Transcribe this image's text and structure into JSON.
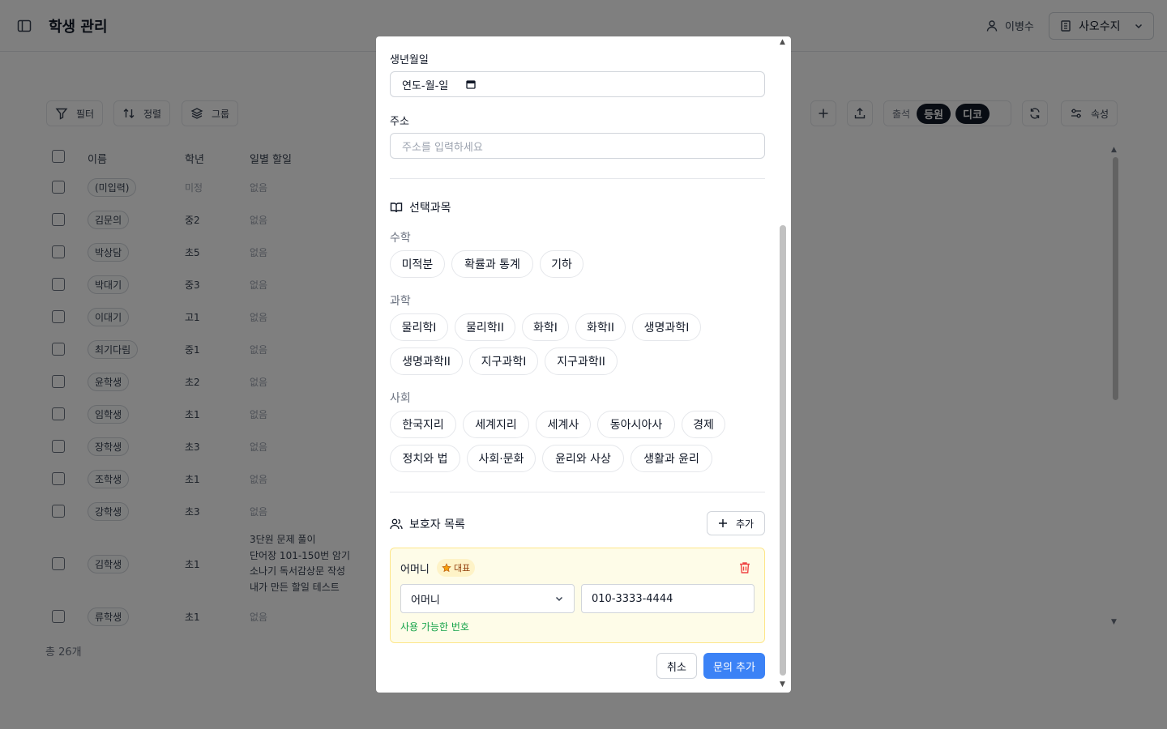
{
  "app": {
    "title": "학생 관리",
    "user_name": "이병수",
    "org_name": "사오수지"
  },
  "toolbar": {
    "filter_label": "필터",
    "sort_label": "정렬",
    "group_label": "그룹",
    "status_options": [
      "출석",
      "등원",
      "디코"
    ],
    "properties_label": "속성"
  },
  "table": {
    "headers": {
      "name": "이름",
      "grade": "학년",
      "todo": "일별 할일"
    },
    "rows": [
      {
        "name": "(미입력)",
        "grade": "미정",
        "todo": "없음"
      },
      {
        "name": "김문의",
        "grade": "중2",
        "todo": "없음"
      },
      {
        "name": "박상담",
        "grade": "초5",
        "todo": "없음"
      },
      {
        "name": "박대기",
        "grade": "중3",
        "todo": "없음"
      },
      {
        "name": "이대기",
        "grade": "고1",
        "todo": "없음"
      },
      {
        "name": "최기다림",
        "grade": "중1",
        "todo": "없음"
      },
      {
        "name": "윤학생",
        "grade": "초2",
        "todo": "없음"
      },
      {
        "name": "임학생",
        "grade": "초1",
        "todo": "없음"
      },
      {
        "name": "장학생",
        "grade": "초3",
        "todo": "없음"
      },
      {
        "name": "조학생",
        "grade": "초1",
        "todo": "없음"
      },
      {
        "name": "강학생",
        "grade": "초3",
        "todo": "없음"
      },
      {
        "name": "김학생",
        "grade": "초1",
        "todo_lines": [
          "3단원 문제 풀이",
          "단어장 101-150번 암기",
          "소나기 독서감상문 작성",
          "내가 만든 할일 테스트"
        ]
      },
      {
        "name": "류학생",
        "grade": "초1",
        "todo": "없음"
      }
    ],
    "total": "총 26개"
  },
  "modal": {
    "birthdate_label": "생년월일",
    "birthdate_value": "연도-월-일",
    "address_label": "주소",
    "address_placeholder": "주소를 입력하세요",
    "subjects_title": "선택과목",
    "categories": [
      {
        "label": "수학",
        "subjects": [
          "미적분",
          "확률과 통계",
          "기하"
        ]
      },
      {
        "label": "과학",
        "subjects": [
          "물리학I",
          "물리학II",
          "화학I",
          "화학II",
          "생명과학I",
          "생명과학II",
          "지구과학I",
          "지구과학II"
        ]
      },
      {
        "label": "사회",
        "subjects": [
          "한국지리",
          "세계지리",
          "세계사",
          "동아시아사",
          "경제",
          "정치와 법",
          "사회·문화",
          "윤리와 사상",
          "생활과 윤리"
        ]
      }
    ],
    "guardians_title": "보호자 목록",
    "add_label": "추가",
    "guardian": {
      "name": "어머니",
      "badge": "대표",
      "relation": "어머니",
      "phone": "010-3333-4444",
      "status": "사용 가능한 번호"
    },
    "cancel_label": "취소",
    "submit_label": "문의 추가"
  },
  "colors": {
    "primary": "#3b82f6",
    "success": "#16a34a",
    "danger": "#ef4444",
    "guardian_card_bg": "#fefce8",
    "badge_star": "#f59e0b"
  }
}
